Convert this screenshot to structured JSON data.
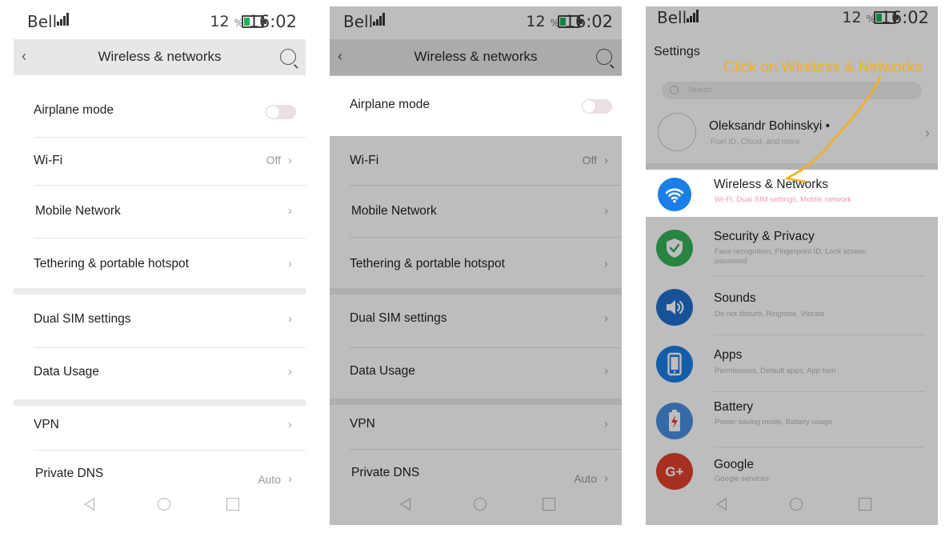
{
  "status": {
    "carrier": "Bell",
    "battery_percent": "12",
    "percent_sign": "%",
    "time": "16:02"
  },
  "wireless_screen": {
    "title": "Wireless & networks",
    "airplane_mode": "Airplane mode",
    "wifi": "Wi-Fi",
    "wifi_value": "Off",
    "mobile_network": "Mobile Network",
    "tethering": "Tethering & portable hotspot",
    "dual_sim": "Dual SIM settings",
    "data_usage": "Data Usage",
    "vpn": "VPN",
    "private_dns": "Private DNS",
    "private_dns_value": "Auto"
  },
  "settings_screen": {
    "title": "Settings",
    "search_placeholder": "Search",
    "account_name": "Oleksandr Bohinskyi",
    "account_sub": "Fuel ID, Cloud, and more",
    "items": [
      {
        "name": "Wireless & Networks",
        "desc": "Wi-Fi, Dual SIM settings, Mobile network",
        "icon": "wifi-icon",
        "color": "#1a7ee6"
      },
      {
        "name": "Security & Privacy",
        "desc": "Face recognition, Fingerprint ID, Lock screen password",
        "icon": "shield-icon",
        "color": "#35b35a"
      },
      {
        "name": "Sounds",
        "desc": "Do not disturb, Ringtone, Vibrate",
        "icon": "speaker-icon",
        "color": "#1f6fce"
      },
      {
        "name": "Apps",
        "desc": "Permissions, Default apps, App twin",
        "icon": "phone-icon",
        "color": "#1a7ee6"
      },
      {
        "name": "Battery",
        "desc": "Power saving mode, Battery usage",
        "icon": "battery-icon",
        "color": "#4a8fe0"
      },
      {
        "name": "Google",
        "desc": "Google services",
        "icon": "google-icon",
        "color": "#e0432f"
      }
    ]
  },
  "annotation": {
    "text": "Click on Wireless & Networks",
    "color": "#f3b11f"
  }
}
